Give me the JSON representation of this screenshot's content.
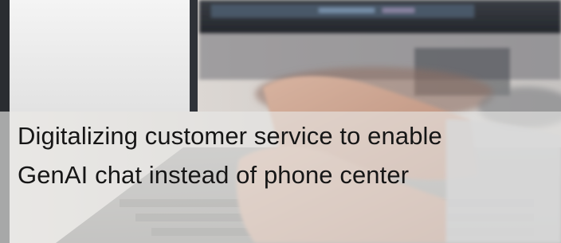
{
  "caption": {
    "line1": "Digitalizing customer service to enable",
    "line2": "GenAI chat instead of phone center"
  },
  "colors": {
    "caption_text": "#161616",
    "caption_band": "#e8e8e6",
    "monitor": "#2b2f36",
    "skin": "#c9a08c",
    "laptop_body": "#b9b8b6"
  },
  "icons": {
    "background": "laptop-typing-photo"
  }
}
